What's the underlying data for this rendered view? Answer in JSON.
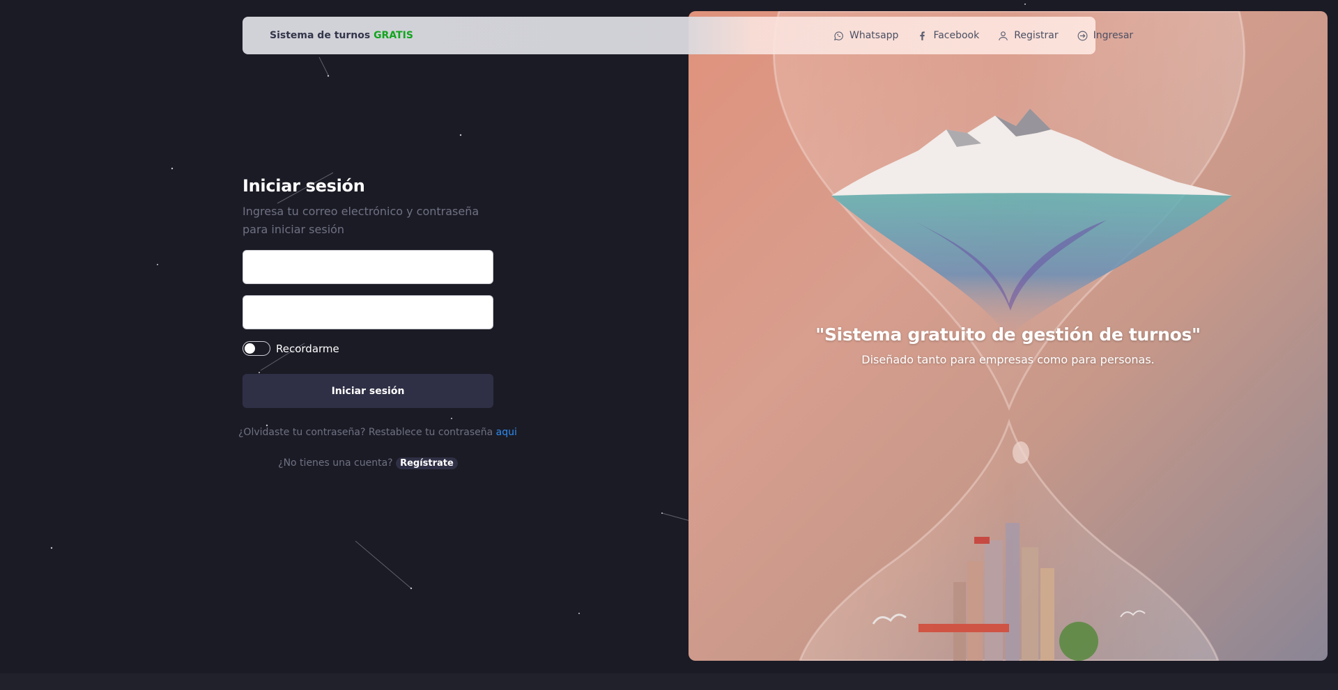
{
  "navbar": {
    "brand_text": "Sistema de turnos",
    "brand_highlight": "GRATIS",
    "links": [
      {
        "label": "Whatsapp",
        "icon": "whatsapp-icon"
      },
      {
        "label": "Facebook",
        "icon": "facebook-icon"
      },
      {
        "label": "Registrar",
        "icon": "user-icon"
      },
      {
        "label": "Ingresar",
        "icon": "sign-in-icon"
      }
    ]
  },
  "login": {
    "title": "Iniciar sesión",
    "subtitle": "Ingresa tu correo electrónico y contraseña para iniciar sesión",
    "email_value": "",
    "password_value": "",
    "remember_label": "Recordarme",
    "remember_checked": false,
    "submit_label": "Iniciar sesión",
    "forgot_text": "¿Olvidaste tu contraseña? Restablece tu contraseña",
    "forgot_link": "aqui",
    "signup_text": "¿No tienes una cuenta?",
    "signup_link": "Regístrate"
  },
  "hero": {
    "title": "\"Sistema gratuito de gestión de turnos\"",
    "subtitle": "Diseñado tanto para empresas como para personas."
  },
  "colors": {
    "background": "#1b1b25",
    "button": "#2f2f45",
    "brand_highlight": "#12a51e",
    "link": "#2e8bf0",
    "hero_peach": "#df927c"
  }
}
